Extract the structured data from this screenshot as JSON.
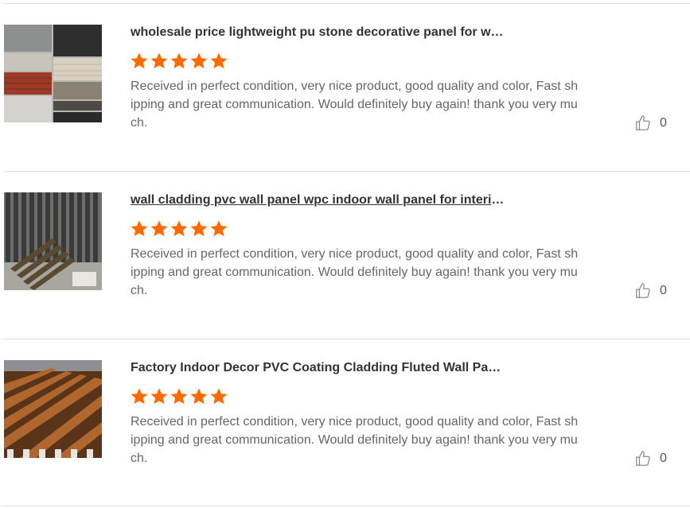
{
  "reviews": [
    {
      "title": "wholesale price lightweight pu stone decorative panel for wall",
      "rating": 5,
      "text": "Received in perfect condition, very nice product, good quality and color, Fast shipping and great communication. Would definitely buy again! thank you very much.",
      "likes": "0",
      "image_icon": "stone-panel-samples"
    },
    {
      "title": "wall cladding pvc wall panel wpc indoor wall panel for interior decoration",
      "rating": 5,
      "text": "Received in perfect condition, very nice product, good quality and color, Fast shipping and great communication. Would definitely buy again! thank you very much.",
      "likes": "0",
      "image_icon": "fluted-wall-panels"
    },
    {
      "title": "Factory Indoor Decor PVC Coating Cladding Fluted Wall Panel",
      "rating": 5,
      "text": "Received in perfect condition, very nice product, good quality and color, Fast shipping and great communication. Would definitely buy again! thank you very much.",
      "likes": "0",
      "image_icon": "wood-grain-panels"
    }
  ],
  "colors": {
    "star": "#ff6a00",
    "divider": "#dedede",
    "title": "#333333",
    "body": "#666666"
  }
}
